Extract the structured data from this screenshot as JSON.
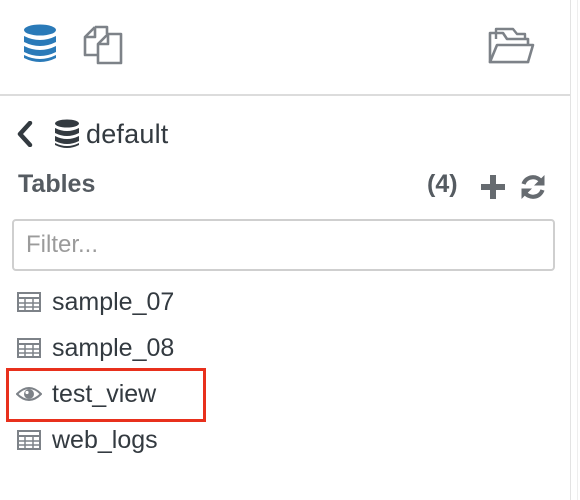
{
  "toolbar": {
    "tabs": [
      {
        "name": "databases",
        "icon": "database-icon",
        "active": true
      },
      {
        "name": "documents",
        "icon": "copy-icon",
        "active": false
      },
      {
        "name": "files",
        "icon": "folder-open-icon",
        "active": false
      }
    ]
  },
  "breadcrumb": {
    "back_icon": "chevron-left-icon",
    "database_icon": "database-icon",
    "database_name": "default"
  },
  "section": {
    "title": "Tables",
    "count": "(4)",
    "add_icon": "plus-icon",
    "refresh_icon": "refresh-icon"
  },
  "filter": {
    "value": "",
    "placeholder": "Filter..."
  },
  "tables": [
    {
      "name": "sample_07",
      "kind": "table",
      "icon": "table-icon"
    },
    {
      "name": "sample_08",
      "kind": "table",
      "icon": "table-icon"
    },
    {
      "name": "test_view",
      "kind": "view",
      "icon": "eye-icon",
      "highlighted": true
    },
    {
      "name": "web_logs",
      "kind": "table",
      "icon": "table-icon"
    }
  ],
  "colors": {
    "active_tab": "#2a7ab8",
    "inactive_icon": "#7d8288",
    "text": "#333a40",
    "highlight": "#e8301c"
  }
}
